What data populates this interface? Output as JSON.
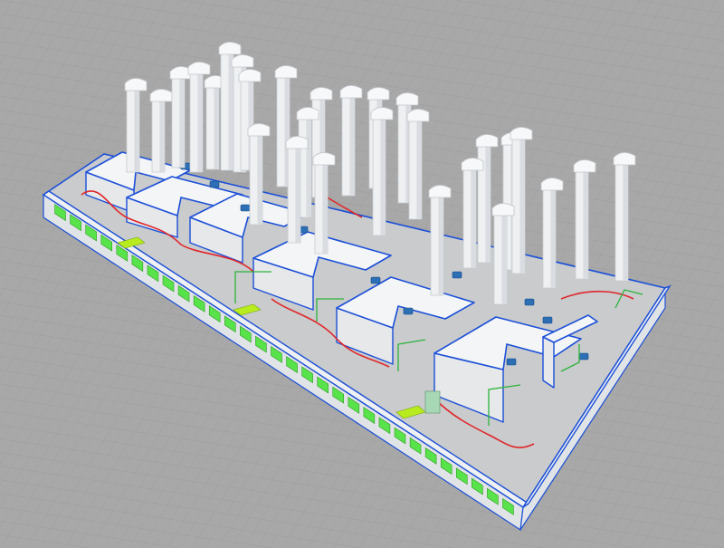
{
  "scene": {
    "colors": {
      "background": "#a6a6a6",
      "outline": "#1b4fd8",
      "booth": "#f4f5f6",
      "windows": "#59e34a",
      "pipes_red": "#e0262a",
      "pipes_green": "#2cb43a",
      "fans": "#2d6fb5",
      "doors": "#b9ec1f"
    },
    "icons": [
      "exhaust-stack-icon",
      "fan-unit-icon",
      "control-cabinet-icon"
    ]
  }
}
